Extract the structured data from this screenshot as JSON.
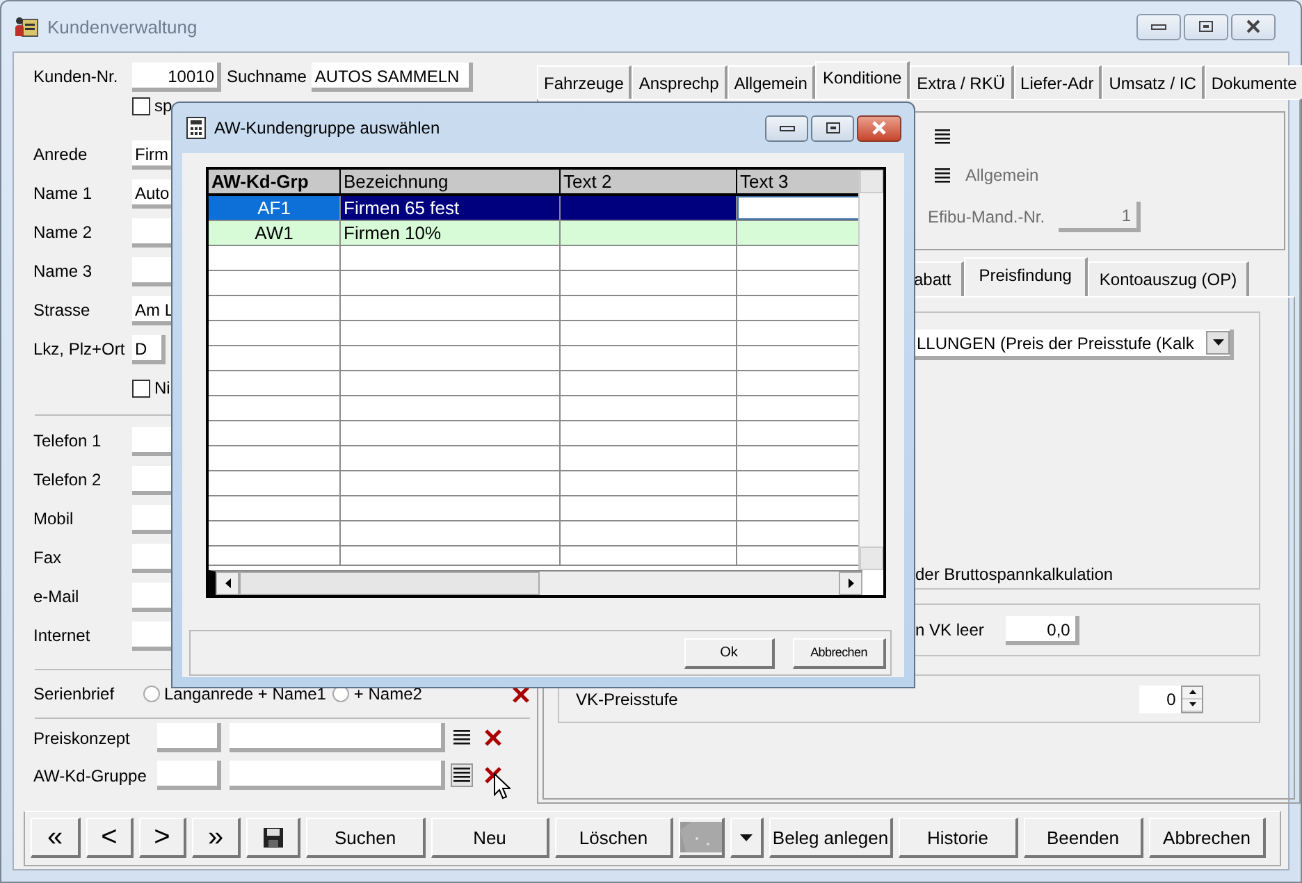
{
  "window": {
    "title": "Kundenverwaltung"
  },
  "header": {
    "kunden_nr_label": "Kunden-Nr.",
    "kunden_nr": "10010",
    "suchname_label": "Suchname",
    "suchname": "AUTOS SAMMELN",
    "checkbox": {
      "label": "sp",
      "checked": false
    }
  },
  "address_fields": [
    {
      "label": "Anrede",
      "value": "Firm",
      "kind": "text"
    },
    {
      "label": "Name 1",
      "value": "Auto",
      "kind": "text"
    },
    {
      "label": "Name 2",
      "kind": "text"
    },
    {
      "label": "Name 3",
      "kind": "text"
    },
    {
      "label": "Strasse",
      "value": "Am L",
      "kind": "text"
    },
    {
      "label": "Lkz, Plz+Ort",
      "value": "D",
      "kind": "country"
    }
  ],
  "address_checkbox": {
    "label": "Ni",
    "checked": false
  },
  "contact_fields": [
    {
      "label": "Telefon 1"
    },
    {
      "label": "Telefon 2"
    },
    {
      "label": "Mobil"
    },
    {
      "label": "Fax"
    },
    {
      "label": "e-Mail"
    },
    {
      "label": "Internet"
    }
  ],
  "serienbrief": {
    "label": "Serienbrief",
    "options": [
      {
        "label": "Langanrede + Name1",
        "selected": false
      },
      {
        "label": "+ Name2",
        "selected": false
      }
    ]
  },
  "lookups": [
    {
      "label": "Preiskonzept",
      "hovered": false
    },
    {
      "label": "AW-Kd-Gruppe",
      "hovered": true
    }
  ],
  "tabs": [
    {
      "label": "Fahrzeuge",
      "selected": false
    },
    {
      "label": "Ansprechp",
      "selected": false
    },
    {
      "label": "Allgemein",
      "selected": false
    },
    {
      "label": "Konditione",
      "selected": true
    },
    {
      "label": "Extra / RKÜ",
      "selected": false
    },
    {
      "label": "Liefer-Adr",
      "selected": false
    },
    {
      "label": "Umsatz / IC",
      "selected": false
    },
    {
      "label": "Dokumente",
      "selected": false
    }
  ],
  "konditionen": {
    "allgemein": "Allgemein",
    "efibu_label": "Efibu-Mand.-Nr.",
    "efibu": "1"
  },
  "subtabs": [
    {
      "label": "abatt",
      "selected": false
    },
    {
      "label": "Preisfindung",
      "selected": true
    },
    {
      "label": "Kontoauszug (OP)",
      "selected": false
    }
  ],
  "preisfindung": {
    "dropdown": "LLUNGEN (Preis der Preisstufe (Kalk",
    "note": "der Bruttospannkalkulation",
    "vk_label": "n VK leer",
    "vk_value": "0,0",
    "stufe_label": "VK-Preisstufe",
    "stufe_value": "0"
  },
  "toolbar": [
    {
      "kind": "text",
      "label": "«"
    },
    {
      "kind": "text",
      "label": "<"
    },
    {
      "kind": "text",
      "label": ">"
    },
    {
      "kind": "text",
      "label": "»"
    },
    {
      "kind": "save"
    },
    {
      "kind": "text",
      "label": "Suchen"
    },
    {
      "kind": "text",
      "label": "Neu"
    },
    {
      "kind": "text",
      "label": "Löschen"
    },
    {
      "kind": "image"
    },
    {
      "kind": "dropdown"
    },
    {
      "kind": "text",
      "label": "Beleg anlegen"
    },
    {
      "kind": "text",
      "label": "Historie"
    },
    {
      "kind": "text",
      "label": "Beenden"
    },
    {
      "kind": "text",
      "label": "Abbrechen"
    }
  ],
  "dialog": {
    "title": "AW-Kundengruppe auswählen",
    "columns": [
      "AW-Kd-Grp",
      "Bezeichnung",
      "Text 2",
      "Text 3"
    ],
    "rows": [
      {
        "cells": [
          "AF1",
          "Firmen 65 fest"
        ],
        "selected": true,
        "marked": false
      },
      {
        "cells": [
          "AW1",
          "Firmen 10%"
        ],
        "selected": false,
        "marked": true
      }
    ],
    "buttons": [
      "Ok",
      "Abbrechen"
    ]
  }
}
